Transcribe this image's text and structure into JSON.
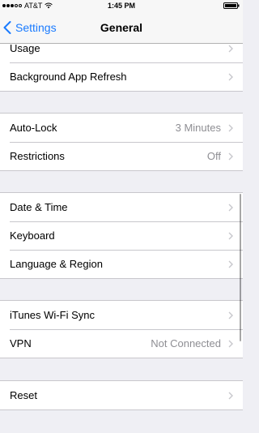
{
  "status_bar": {
    "carrier": "AT&T",
    "time": "1:45 PM"
  },
  "nav": {
    "back_label": "Settings",
    "title": "General"
  },
  "groups": [
    {
      "rows": [
        {
          "label": "Usage",
          "value": ""
        },
        {
          "label": "Background App Refresh",
          "value": ""
        }
      ]
    },
    {
      "rows": [
        {
          "label": "Auto-Lock",
          "value": "3 Minutes"
        },
        {
          "label": "Restrictions",
          "value": "Off"
        }
      ]
    },
    {
      "rows": [
        {
          "label": "Date & Time",
          "value": ""
        },
        {
          "label": "Keyboard",
          "value": ""
        },
        {
          "label": "Language & Region",
          "value": ""
        }
      ]
    },
    {
      "rows": [
        {
          "label": "iTunes Wi-Fi Sync",
          "value": ""
        },
        {
          "label": "VPN",
          "value": "Not Connected"
        }
      ]
    },
    {
      "rows": [
        {
          "label": "Reset",
          "value": ""
        }
      ]
    }
  ],
  "colors": {
    "accent": "#1a7bff",
    "background": "#efeff4",
    "secondary_text": "#8e8e93"
  }
}
